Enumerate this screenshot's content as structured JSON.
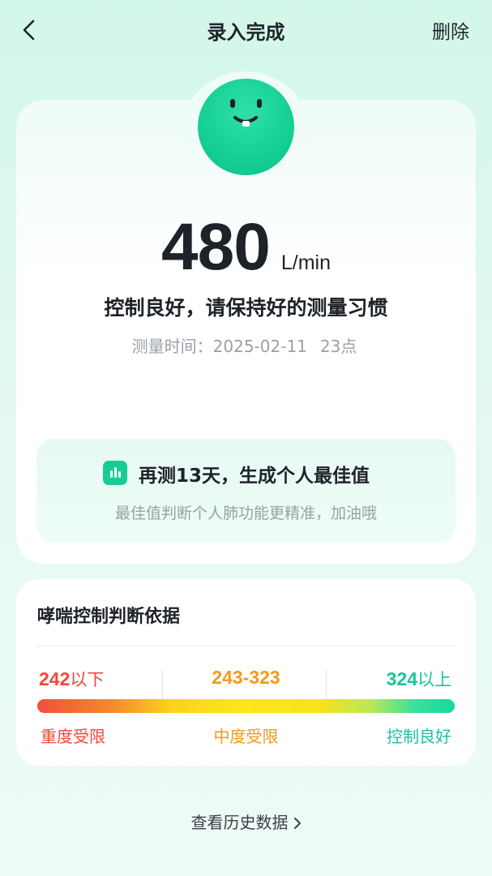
{
  "header": {
    "title": "录入完成",
    "delete_label": "删除"
  },
  "result": {
    "value": "480",
    "unit": "L/min",
    "status": "控制良好，请保持好的测量习惯",
    "time_label": "测量时间：",
    "date": "2025-02-11",
    "hour": "23点"
  },
  "tip": {
    "title": "再测13天，生成个人最佳值",
    "subtitle": "最佳值判断个人肺功能更精准，加油哦"
  },
  "criteria": {
    "title": "哮喘控制判断依据",
    "ranges": [
      {
        "value": "242",
        "suffix": "以下",
        "label": "重度受限",
        "color": "#ee4a3a"
      },
      {
        "value": "243-323",
        "suffix": "",
        "label": "中度受限",
        "color": "#f29a1a"
      },
      {
        "value": "324",
        "suffix": "以上",
        "label": "控制良好",
        "color": "#18c49b"
      }
    ]
  },
  "history_link": "查看历史数据",
  "colors": {
    "accent": "#18cc96",
    "danger": "#ee4a3a",
    "warning": "#f29a1a",
    "good": "#18c49b"
  }
}
